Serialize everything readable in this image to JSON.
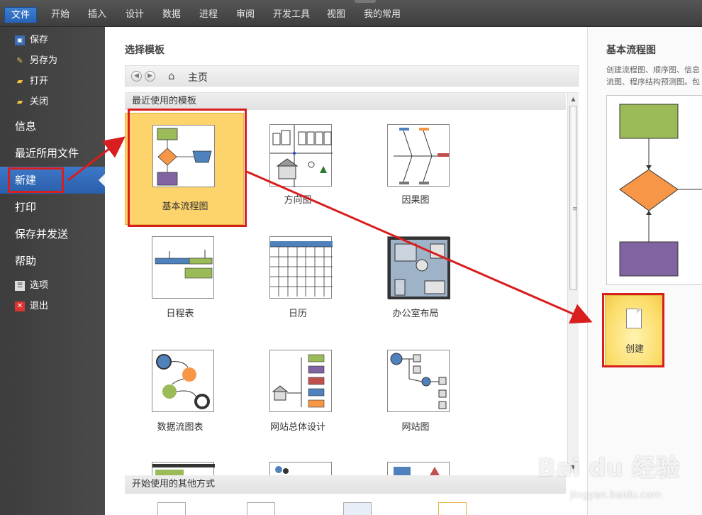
{
  "ribbon": {
    "tabs": [
      "文件",
      "开始",
      "插入",
      "设计",
      "数据",
      "进程",
      "审阅",
      "开发工具",
      "视图",
      "我的常用"
    ],
    "active_tab": "文件"
  },
  "leftnav": {
    "save": "保存",
    "save_as": "另存为",
    "open": "打开",
    "close": "关闭",
    "info": "信息",
    "recent": "最近所用文件",
    "new": "新建",
    "print": "打印",
    "save_send": "保存并发送",
    "help": "帮助",
    "options": "选项",
    "exit": "退出"
  },
  "center": {
    "title": "选择模板",
    "path": "主页",
    "recent_header": "最近使用的模板",
    "templates": [
      "基本流程图",
      "方向图",
      "因果图",
      "日程表",
      "日历",
      "办公室布局",
      "数据流图表",
      "网站总体设计",
      "网站图"
    ],
    "selected_template": "基本流程图",
    "other_header": "开始使用的其他方式"
  },
  "preview": {
    "title": "基本流程图",
    "description": "创建流程图、顺序图、信息流图、程序结构预测图。包含连接线和链接。",
    "create_label": "创建"
  },
  "colors": {
    "accent_blue": "#2a5fab",
    "selected_tile": "#fdd36b",
    "annotation_red": "#d81e1e",
    "flow_green": "#9bbb59",
    "flow_orange": "#f79646",
    "flow_purple": "#8064a2",
    "flow_blue": "#4f81bd"
  },
  "watermark": {
    "brand": "Bai du 经验",
    "url": "jingyan.baidu.com"
  }
}
